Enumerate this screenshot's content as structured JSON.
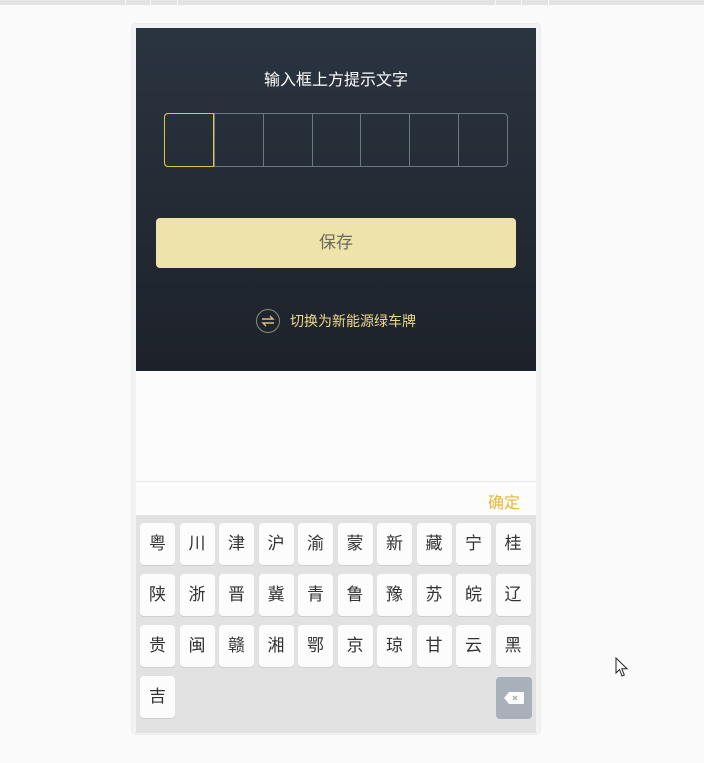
{
  "prompt": "输入框上方提示文字",
  "plate": {
    "cells": [
      "",
      "",
      "",
      "",
      "",
      "",
      ""
    ]
  },
  "save_label": "保存",
  "switch_label": "切换为新能源绿车牌",
  "confirm_label": "确定",
  "keyboard": {
    "rows": [
      [
        "粤",
        "川",
        "津",
        "沪",
        "渝",
        "蒙",
        "新",
        "藏",
        "宁",
        "桂"
      ],
      [
        "陕",
        "浙",
        "晋",
        "冀",
        "青",
        "鲁",
        "豫",
        "苏",
        "皖",
        "辽"
      ],
      [
        "贵",
        "闽",
        "赣",
        "湘",
        "鄂",
        "京",
        "琼",
        "甘",
        "云",
        "黑"
      ],
      [
        "吉"
      ]
    ]
  },
  "icons": {
    "switch": "swap-arrows-icon",
    "delete": "backspace-icon",
    "cursor": "mouse-pointer-icon"
  },
  "colors": {
    "header_top": "#2a3440",
    "header_bottom": "#1d222a",
    "active_cell_border": "#e7c53b",
    "save_button": "#eee3ab",
    "switch_text": "#ecd88c",
    "confirm_text": "#e9b63a",
    "keyboard_bg": "#e2e2e2",
    "delete_key": "#a8b1ba"
  }
}
